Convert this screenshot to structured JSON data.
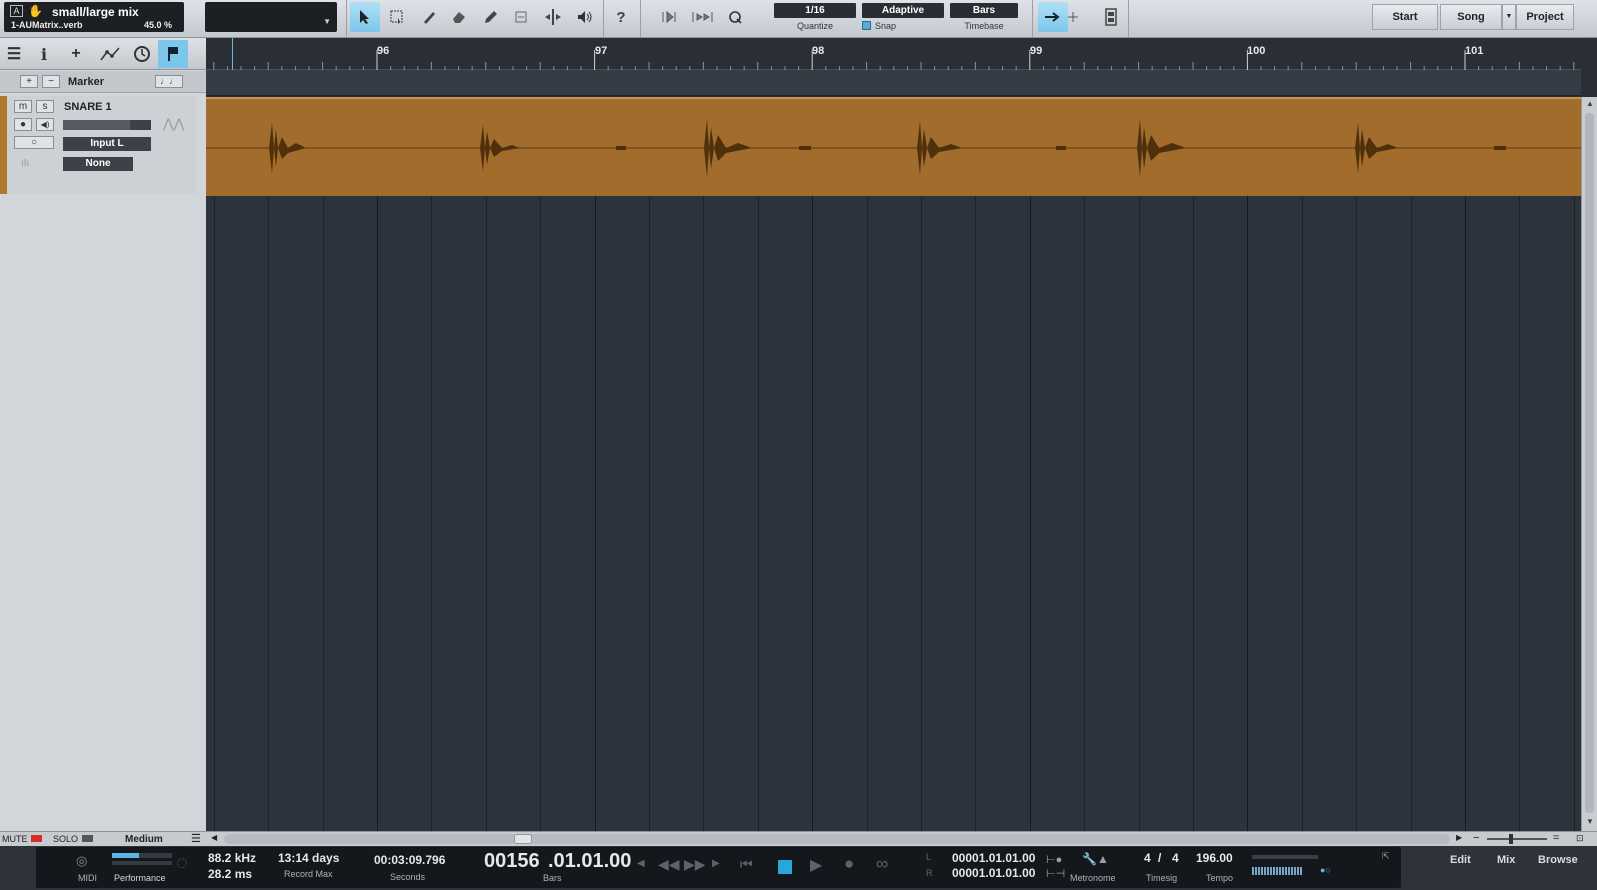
{
  "toolbar": {
    "preset_title": "small/large mix",
    "preset_sub": "1-AUMatrix..verb",
    "preset_pct": "45.0 %",
    "quantize_value": "1/16",
    "quantize_label": "Quantize",
    "snap_value": "Adaptive",
    "snap_label": "Snap",
    "timebase_value": "Bars",
    "timebase_label": "Timebase",
    "start_label": "Start",
    "song_label": "Song",
    "project_label": "Project",
    "help_label": "?"
  },
  "left": {
    "marker_label": "Marker",
    "track_name": "SNARE 1",
    "mute": "m",
    "solo": "s",
    "input": "Input L",
    "output": "None"
  },
  "ruler": {
    "bars": [
      "96",
      "97",
      "98",
      "99",
      "100",
      "101"
    ]
  },
  "strip": {
    "mute_label": "MUTE",
    "solo_label": "SOLO",
    "zoom_label": "Medium"
  },
  "transport": {
    "midi_label": "MIDI",
    "performance_label": "Performance",
    "sample_rate": "88.2 kHz",
    "latency": "28.2 ms",
    "record_max": "13:14 days",
    "record_max_label": "Record Max",
    "seconds": "00:03:09.796",
    "seconds_label": "Seconds",
    "bars_main": "00156",
    "bars_rest": ".01.01.00",
    "bars_label": "Bars",
    "loop_l": "00001.01.01.00",
    "loop_r": "00001.01.01.00",
    "l_label": "L",
    "r_label": "R",
    "metronome_label": "Metronome",
    "timesig_num": "4",
    "timesig_slash": "/",
    "timesig_den": "4",
    "timesig_label": "Timesig",
    "tempo": "196.00",
    "tempo_label": "Tempo"
  },
  "nav": {
    "edit": "Edit",
    "mix": "Mix",
    "browse": "Browse"
  },
  "colors": {
    "event": "#a26c2c",
    "accent": "#7cc6ea",
    "mute": "#d92b2b"
  }
}
